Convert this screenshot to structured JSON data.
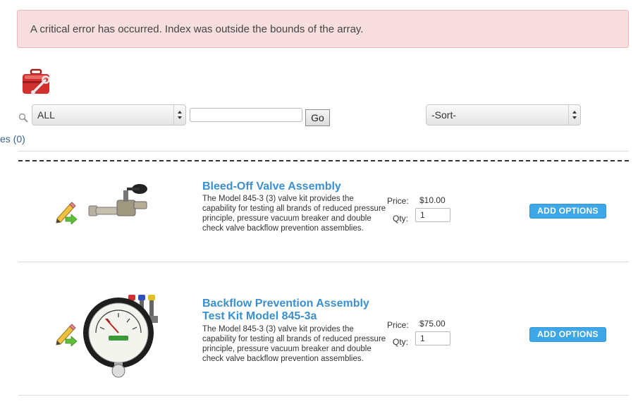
{
  "alert": {
    "message": "A critical error has occurred. Index was outside the bounds of the array."
  },
  "toolbar": {
    "filter_value": "ALL",
    "search_value": "",
    "go_label": "Go",
    "sort_value": "-Sort-",
    "compare_link": "es (0)"
  },
  "icons": {
    "toolbox": "toolbox-icon",
    "search": "search-icon",
    "edit": "pencil-edit-icon"
  },
  "colors": {
    "alert_bg": "#f8dede",
    "title_link": "#3a8fd0",
    "add_button": "#3da7e8"
  },
  "products": [
    {
      "title": "Bleed-Off Valve Assembly",
      "description": "The Model 845-3 (3) valve kit provides the capability for testing all brands of reduced pressure principle, pressure vacuum breaker and double check valve backflow prevention assemblies.",
      "price_label": "Price:",
      "price": "$10.00",
      "qty_label": "Qty:",
      "qty": "1",
      "button": "ADD OPTIONS"
    },
    {
      "title": "Backflow Prevention Assembly Test Kit Model 845-3a",
      "description": "The Model 845-3 (3) valve kit provides the capability for testing all brands of reduced pressure principle, pressure vacuum breaker and double check valve backflow prevention assemblies.",
      "price_label": "Price:",
      "price": "$75.00",
      "qty_label": "Qty:",
      "qty": "1",
      "button": "ADD OPTIONS"
    }
  ]
}
